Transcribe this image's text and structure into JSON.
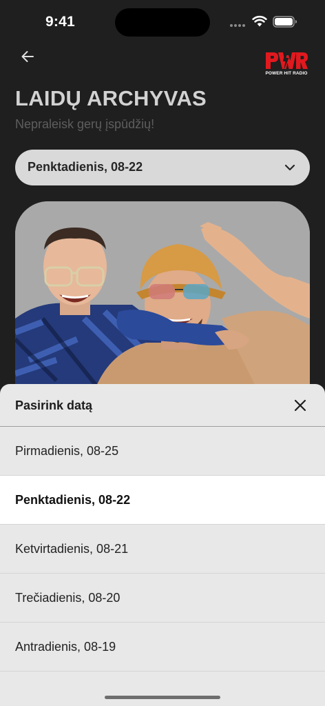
{
  "status_bar": {
    "time": "9:41"
  },
  "header": {
    "back_icon": "arrow-left-icon",
    "logo_text": "PWR",
    "logo_caption": "POWER HIT RADIO"
  },
  "page": {
    "title": "LAIDŲ ARCHYVAS",
    "subtitle": "Nepraleisk gerų įspūdžių!"
  },
  "date_select": {
    "value": "Penktadienis, 08-22",
    "icon": "chevron-down-icon"
  },
  "sheet": {
    "title": "Pasirink datą",
    "close_icon": "close-icon",
    "options": [
      {
        "label": "Pirmadienis, 08-25",
        "selected": false
      },
      {
        "label": "Penktadienis, 08-22",
        "selected": true
      },
      {
        "label": "Ketvirtadienis, 08-21",
        "selected": false
      },
      {
        "label": "Trečiadienis, 08-20",
        "selected": false
      },
      {
        "label": "Antradienis, 08-19",
        "selected": false
      }
    ]
  },
  "colors": {
    "background": "#1f1f1f",
    "accent": "#e1191e",
    "sheet": "#e8e8e8",
    "selected_row": "#ffffff"
  }
}
